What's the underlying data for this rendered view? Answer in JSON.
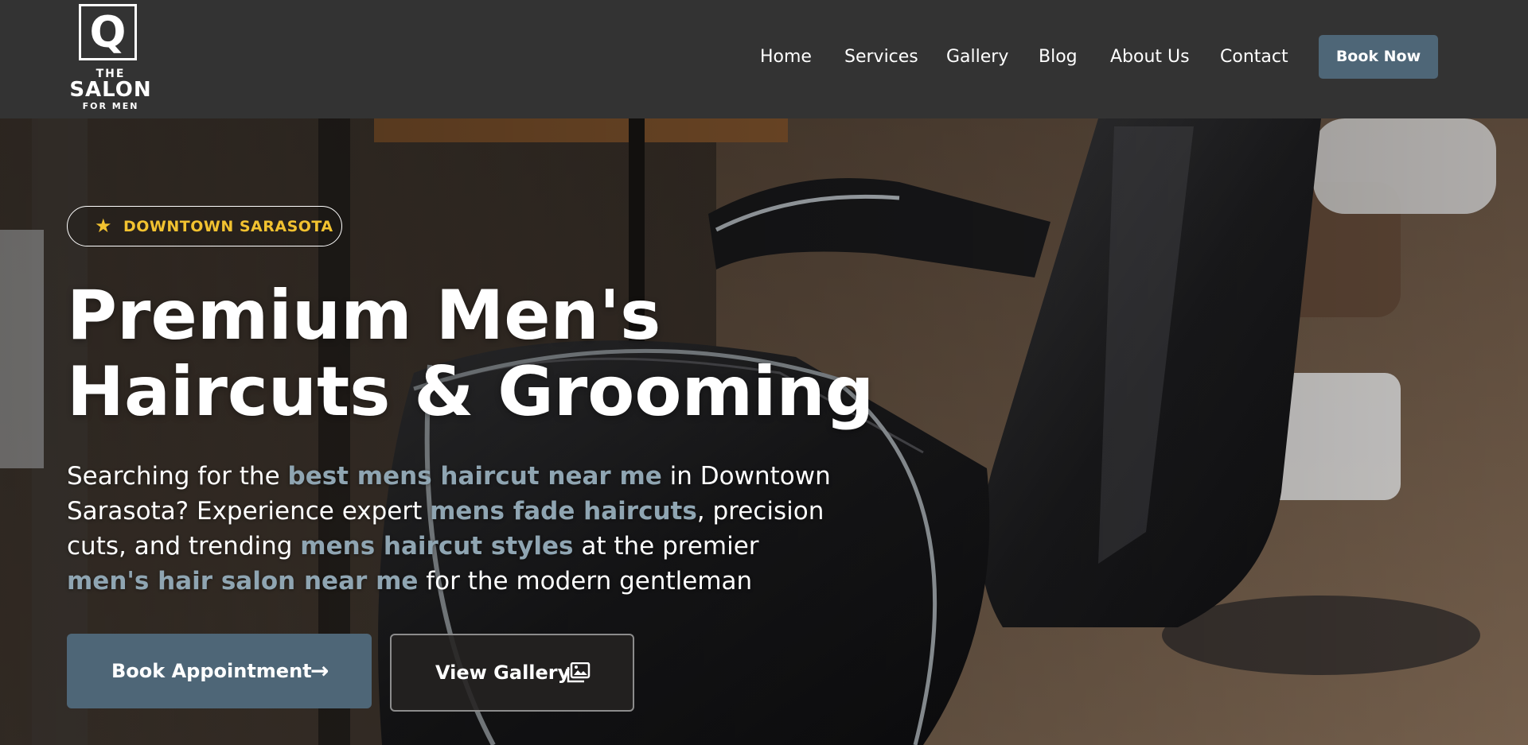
{
  "brand": {
    "logo_letter": "Q",
    "logo_line1": "THE",
    "logo_line2": "SALON",
    "logo_line3": "FOR MEN"
  },
  "nav": {
    "items": [
      {
        "label": "Home"
      },
      {
        "label": "Services"
      },
      {
        "label": "Gallery"
      },
      {
        "label": "Blog"
      },
      {
        "label": "About Us"
      },
      {
        "label": "Contact"
      }
    ],
    "cta_label": "Book Now"
  },
  "hero": {
    "badge": {
      "icon": "star-icon",
      "text": "DOWNTOWN SARASOTA"
    },
    "title_line1": "Premium Men's",
    "title_line2": "Haircuts & Grooming",
    "description": {
      "l1_a": "Searching for the ",
      "l1_kw": "best mens haircut near me",
      "l1_b": " in Downtown",
      "l2_a": "Sarasota? Experience expert ",
      "l2_kw": "mens fade haircuts",
      "l2_b": ", precision",
      "l3_a": "cuts, and trending ",
      "l3_kw": "mens haircut styles",
      "l3_b": " at the premier",
      "l4_kw": "men's hair salon near me",
      "l4_b": " for the modern gentleman"
    },
    "primary_button": {
      "label": "Book Appointment",
      "icon": "arrow-right-icon"
    },
    "secondary_button": {
      "label": "View Gallery",
      "icon": "images-icon"
    }
  },
  "colors": {
    "header_bg": "#333333",
    "accent": "#4e6677",
    "keyword": "#8fa5b2",
    "badge_text": "#f2c230"
  }
}
